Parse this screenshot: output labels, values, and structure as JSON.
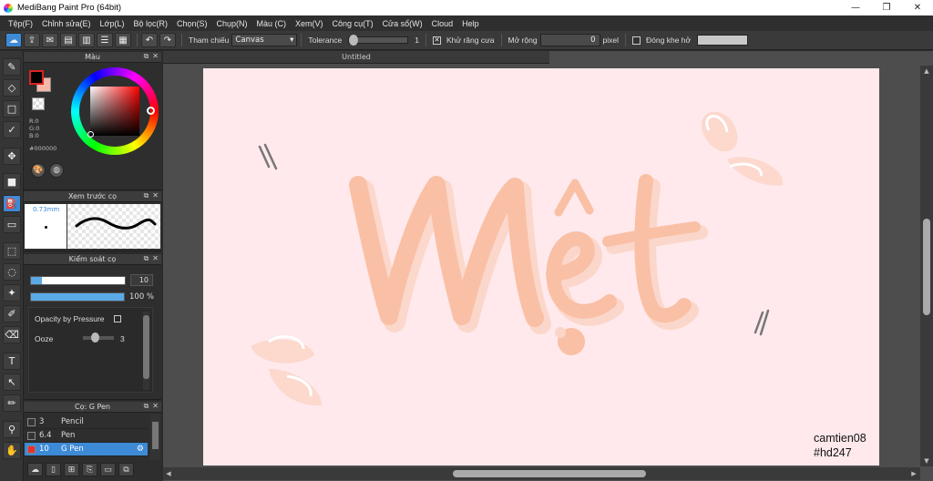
{
  "window": {
    "title": "MediBang Paint Pro (64bit)",
    "minimize": "—",
    "maximize": "❐",
    "close": "✕"
  },
  "menu": [
    "Tệp(F)",
    "Chỉnh sửa(E)",
    "Lớp(L)",
    "Bộ lọc(R)",
    "Chọn(S)",
    "Chụp(N)",
    "Màu (C)",
    "Xem(V)",
    "Công cụ(T)",
    "Cửa sổ(W)",
    "Cloud",
    "Help"
  ],
  "toolbar": {
    "reference_label": "Tham chiếu",
    "reference_value": "Canvas",
    "tolerance_label": "Tolerance",
    "tolerance_value": "1",
    "antialias_label": "Khử răng cưa",
    "expand_label": "Mở rộng",
    "expand_value": "0",
    "expand_unit": "pixel",
    "close_gap_label": "Đóng khe hở",
    "antialias_checked": true,
    "close_gap_checked": false
  },
  "color_panel": {
    "title": "Màu",
    "r": "R:0",
    "g": "G:0",
    "b": "B:0",
    "hex": "#000000",
    "foreground": "#000000",
    "background": "#f5b7a8"
  },
  "preview_panel": {
    "title": "Xem trước cọ",
    "size": "0.73mm"
  },
  "control_panel": {
    "title": "Kiểm soát cọ",
    "size_value": "10",
    "size_fraction": 0.12,
    "opacity_value": "100 %",
    "opacity_fraction": 1.0,
    "opacity_pressure_label": "Opacity by Pressure",
    "opacity_pressure_checked": false,
    "ooze_label": "Ooze",
    "ooze_value": "3"
  },
  "brush_panel": {
    "title": "Cọ: G Pen",
    "brushes": [
      {
        "size": "3",
        "name": "Pencil",
        "color": "#333333",
        "selected": false
      },
      {
        "size": "6.4",
        "name": "Pen",
        "color": "#333333",
        "selected": false
      },
      {
        "size": "10",
        "name": "G Pen",
        "color": "#e83030",
        "selected": true
      }
    ]
  },
  "document": {
    "tab_title": "Untitled"
  },
  "artwork": {
    "lettering": "Mệt",
    "watermark_line1": "camtien08",
    "watermark_line2": "#hd247",
    "accent": "#f9c0a5",
    "shadow": "#fbd6c8"
  },
  "tools": [
    "brush-icon",
    "eraser-icon",
    "shape-icon",
    "pen-icon",
    "move-icon",
    "rect-fill-icon",
    "bucket-icon",
    "gradient-icon",
    "select-rect-icon",
    "lasso-icon",
    "magic-wand-icon",
    "select-pen-icon",
    "select-eraser-icon",
    "text-icon",
    "operation-icon",
    "dropper-icon",
    "hand-icon"
  ]
}
